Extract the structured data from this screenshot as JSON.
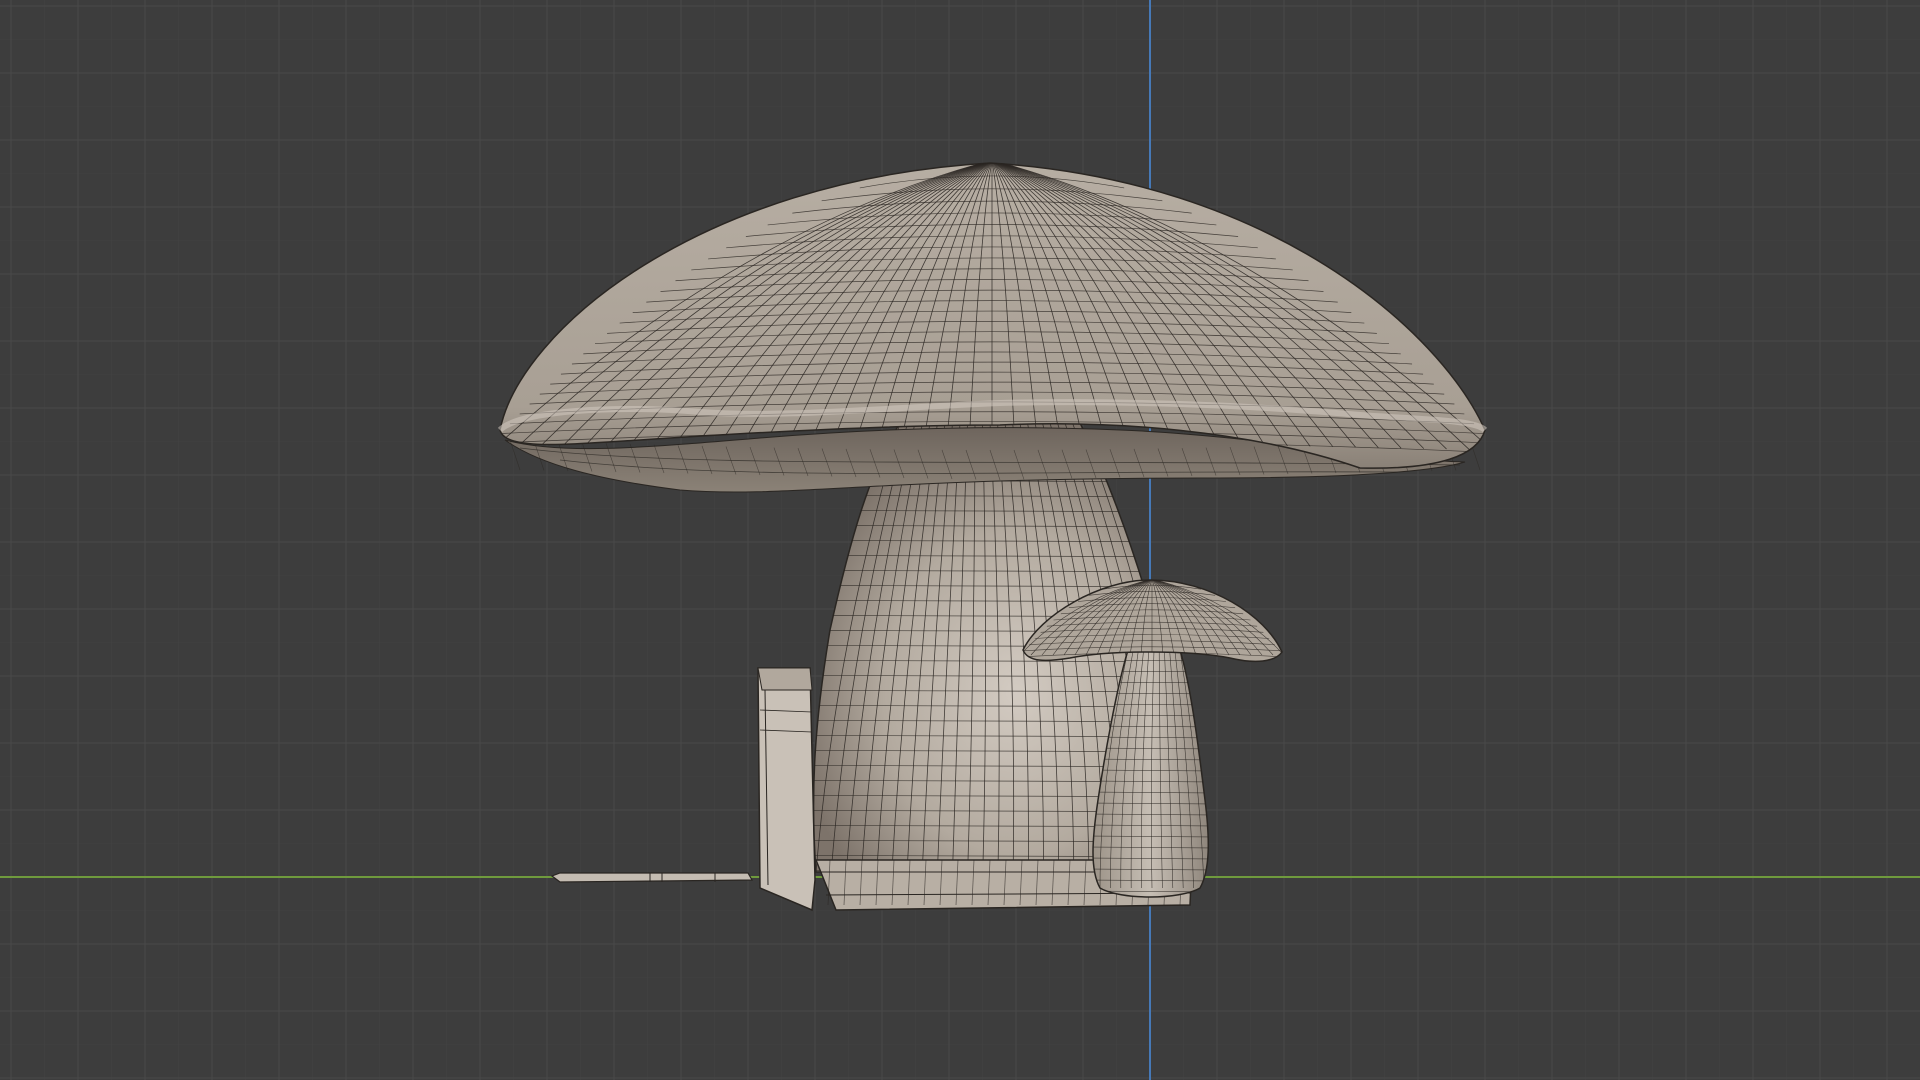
{
  "viewport": {
    "view": "front-orthographic",
    "mode": "object-mode-solid-wireframe-overlay",
    "colors": {
      "background": "#3d3d3d",
      "grid_minor": "#494949",
      "grid_major": "#555555",
      "x_axis": "#6f9a3d",
      "z_axis": "#4679b7",
      "mesh_fill": "#b0a79c",
      "mesh_light": "#cfc7bd",
      "mesh_shadow": "#6b625a",
      "wire": "#2a2622"
    }
  },
  "scene": {
    "objects": [
      "large-mushroom-cap",
      "large-mushroom-stem",
      "small-mushroom-cap",
      "small-mushroom-stem",
      "house-base",
      "door-frame",
      "ground-plank"
    ]
  }
}
